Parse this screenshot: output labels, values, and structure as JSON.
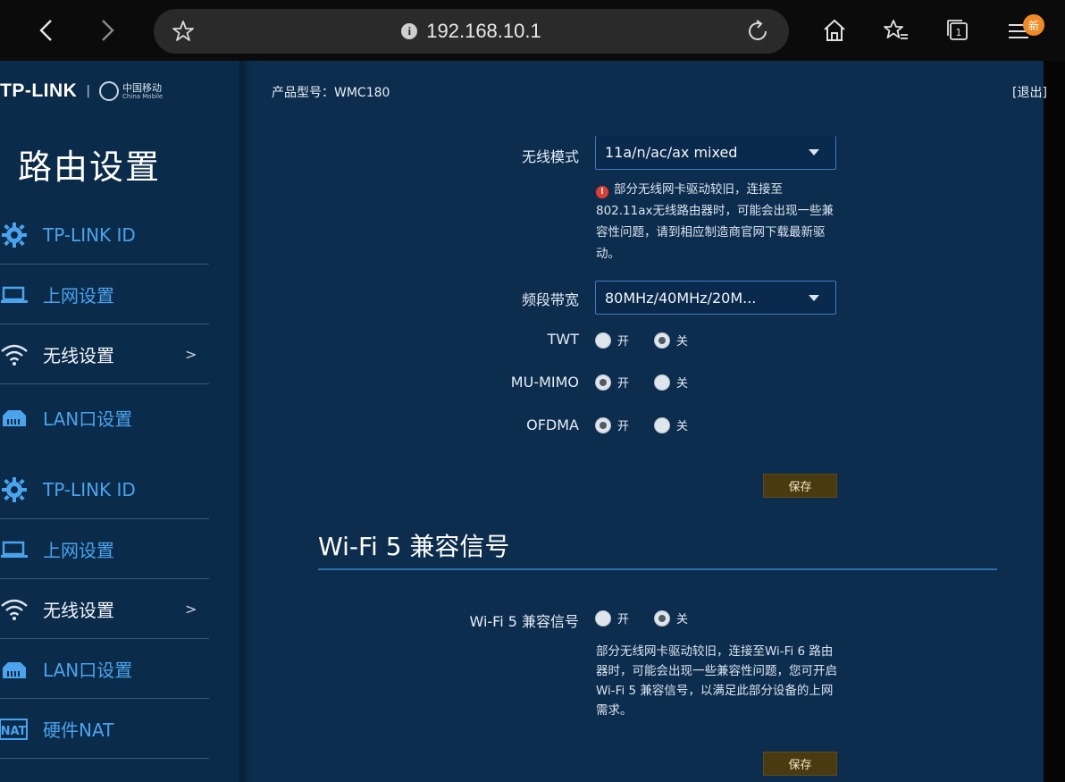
{
  "browser": {
    "url": "192.168.10.1",
    "new_badge": "新"
  },
  "header": {
    "brand": "TP-LINK",
    "partner_cn": "中国移动",
    "partner_en": "China Mobile",
    "model_label": "产品型号：WMC180",
    "logout": "[退出]"
  },
  "sidebar": {
    "title": "路由设置",
    "items": [
      {
        "label": "TP-LINK ID",
        "icon": "gear-icon"
      },
      {
        "label": "上网设置",
        "icon": "laptop-icon"
      },
      {
        "label": "无线设置",
        "icon": "wifi-icon",
        "arrow": ">"
      },
      {
        "label": "LAN口设置",
        "icon": "lan-icon"
      }
    ],
    "items2": [
      {
        "label": "TP-LINK ID",
        "icon": "gear-icon"
      },
      {
        "label": "上网设置",
        "icon": "laptop-icon"
      },
      {
        "label": "无线设置",
        "icon": "wifi-icon",
        "arrow": ">"
      },
      {
        "label": "LAN口设置",
        "icon": "lan-icon"
      },
      {
        "label": "硬件NAT",
        "icon": "nat-icon"
      }
    ]
  },
  "form": {
    "mode_label": "无线模式",
    "mode_value": "11a/n/ac/ax mixed",
    "mode_warning": "部分无线网卡驱动较旧，连接至802.11ax无线路由器时，可能会出现一些兼容性问题，请到相应制造商官网下载最新驱动。",
    "bandwidth_label": "频段带宽",
    "bandwidth_value": "80MHz/40MHz/20M...",
    "twt_label": "TWT",
    "mumimo_label": "MU-MIMO",
    "ofdma_label": "OFDMA",
    "on": "开",
    "off": "关",
    "twt_state": "off",
    "mumimo_state": "on",
    "ofdma_state": "on",
    "save": "保存"
  },
  "wifi5": {
    "title": "Wi-Fi 5 兼容信号",
    "label": "Wi-Fi 5 兼容信号",
    "state": "off",
    "note": "部分无线网卡驱动较旧，连接至Wi-Fi 6 路由器时，可能会出现一些兼容性问题，您可开启Wi-Fi 5 兼容信号，以满足此部分设备的上网需求。",
    "save": "保存"
  }
}
